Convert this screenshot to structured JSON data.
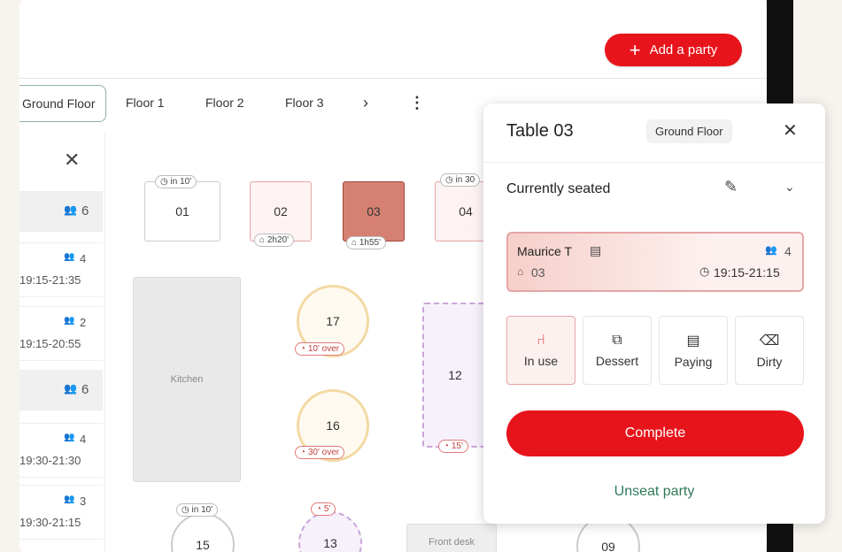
{
  "header": {
    "add_party_label": "Add a party"
  },
  "floors": [
    "Ground Floor",
    "Floor 1",
    "Floor 2",
    "Floor 3"
  ],
  "floors_more": "›",
  "floors_menu": "⋮",
  "sidebar": {
    "close": "✕",
    "items": [
      {
        "count": "6",
        "time": ""
      },
      {
        "count": "4",
        "time": "19:15-21:35"
      },
      {
        "count": "2",
        "time": "19:15-20:55"
      },
      {
        "count": "6",
        "time": ""
      },
      {
        "count": "4",
        "time": "19:30-21:30"
      },
      {
        "count": "3",
        "time": "19:30-21:15"
      }
    ]
  },
  "tables": {
    "t01": {
      "label": "01",
      "tag": "in 10'"
    },
    "t02": {
      "label": "02",
      "tag": "2h20'"
    },
    "t03": {
      "label": "03",
      "tag": "1h55'"
    },
    "t04": {
      "label": "04",
      "tag": "in 30"
    },
    "t17": {
      "label": "17",
      "tag": "10' over"
    },
    "t16": {
      "label": "16",
      "tag": "30' over"
    },
    "t12": {
      "label": "12",
      "tag": "15'"
    },
    "t15": {
      "label": "15",
      "tag": "in 10'"
    },
    "t13": {
      "label": "13",
      "tag": "5'"
    },
    "t09": {
      "label": "09"
    },
    "kitchen": "Kitchen",
    "front_desk": "Front desk"
  },
  "panel": {
    "title": "Table 03",
    "floor_badge": "Ground Floor",
    "section": "Currently seated",
    "guest_name": "Maurice T",
    "guest_count": "4",
    "guest_table": "03",
    "guest_time": "19:15-21:15",
    "statuses": [
      "In use",
      "Dessert",
      "Paying",
      "Dirty"
    ],
    "complete_label": "Complete",
    "unseat_label": "Unseat party"
  },
  "colors": {
    "accent": "#e8141b",
    "unseat_text": "#2f7a5b",
    "seated_fill": "#d68074"
  }
}
